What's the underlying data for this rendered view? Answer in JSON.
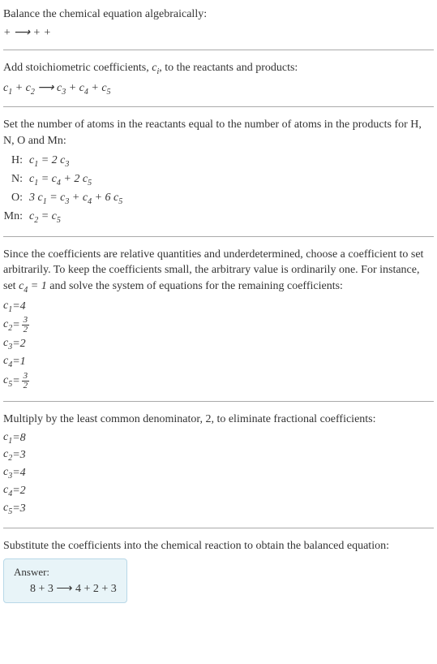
{
  "section1": {
    "title": "Balance the chemical equation algebraically:",
    "equation": " +  ⟶  +  + "
  },
  "section2": {
    "title_part1": "Add stoichiometric coefficients, ",
    "title_var": "c",
    "title_sub": "i",
    "title_part2": ", to the reactants and products:",
    "equation_html": "c₁  + c₂  ⟶ c₃  + c₄  + c₅"
  },
  "section3": {
    "title": "Set the number of atoms in the reactants equal to the number of atoms in the products for H, N, O and Mn:",
    "atoms": [
      {
        "label": "H:",
        "eq": "c₁ = 2 c₃"
      },
      {
        "label": "N:",
        "eq": "c₁ = c₄ + 2 c₅"
      },
      {
        "label": "O:",
        "eq": "3 c₁ = c₃ + c₄ + 6 c₅"
      },
      {
        "label": "Mn:",
        "eq": "c₂ = c₅"
      }
    ]
  },
  "section4": {
    "title_part1": "Since the coefficients are relative quantities and underdetermined, choose a coefficient to set arbitrarily. To keep the coefficients small, the arbitrary value is ordinarily one. For instance, set ",
    "title_var": "c₄ = 1",
    "title_part2": " and solve the system of equations for the remaining coefficients:",
    "coeffs": [
      {
        "var": "c₁",
        "val": "4",
        "frac": null
      },
      {
        "var": "c₂",
        "val": null,
        "frac": {
          "num": "3",
          "den": "2"
        }
      },
      {
        "var": "c₃",
        "val": "2",
        "frac": null
      },
      {
        "var": "c₄",
        "val": "1",
        "frac": null
      },
      {
        "var": "c₅",
        "val": null,
        "frac": {
          "num": "3",
          "den": "2"
        }
      }
    ]
  },
  "section5": {
    "title": "Multiply by the least common denominator, 2, to eliminate fractional coefficients:",
    "coeffs": [
      {
        "var": "c₁",
        "val": "8"
      },
      {
        "var": "c₂",
        "val": "3"
      },
      {
        "var": "c₃",
        "val": "4"
      },
      {
        "var": "c₄",
        "val": "2"
      },
      {
        "var": "c₅",
        "val": "3"
      }
    ]
  },
  "section6": {
    "title": "Substitute the coefficients into the chemical reaction to obtain the balanced equation:"
  },
  "answer": {
    "label": "Answer:",
    "equation": "8  + 3  ⟶ 4  + 2  + 3"
  }
}
